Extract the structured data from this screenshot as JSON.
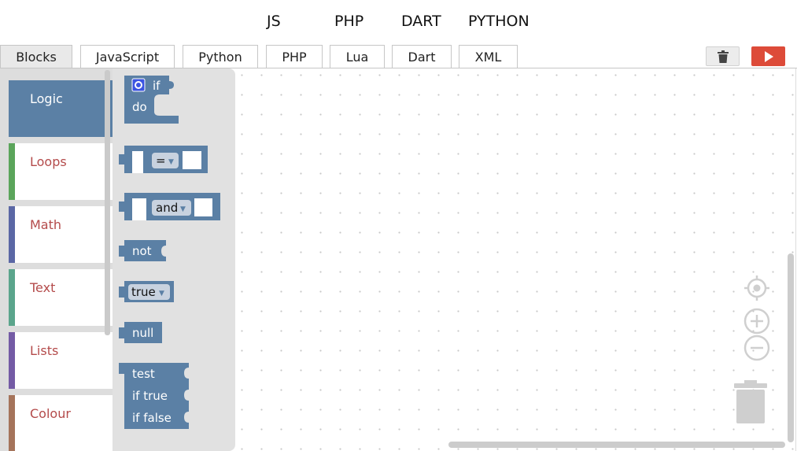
{
  "top_links": [
    "JS",
    "PHP",
    "DART",
    "PYTHON"
  ],
  "tabs": [
    "Blocks",
    "JavaScript",
    "Python",
    "PHP",
    "Lua",
    "Dart",
    "XML"
  ],
  "active_tab": "Blocks",
  "categories": [
    {
      "label": "Logic",
      "color": "#5b80a5"
    },
    {
      "label": "Loops",
      "color": "#5ba55b"
    },
    {
      "label": "Math",
      "color": "#5b67a5"
    },
    {
      "label": "Text",
      "color": "#5ba58c"
    },
    {
      "label": "Lists",
      "color": "#745ba5"
    },
    {
      "label": "Colour",
      "color": "#a5745b"
    }
  ],
  "selected_category": "Logic",
  "category_label_color": "#b44b4b",
  "block_color": "#5b80a5",
  "blocks": {
    "if_label": "if",
    "do_label": "do",
    "compare_op": "=",
    "logic_op": "and",
    "not_label": "not",
    "boolean_value": "true",
    "null_label": "null",
    "ternary_test": "test",
    "ternary_true": "if  true",
    "ternary_false": "if  false"
  },
  "icons": {
    "delete_button": "trash-icon",
    "run_button": "play-icon",
    "recenter": "crosshair-icon",
    "zoom_in": "zoom-in-icon",
    "zoom_out": "zoom-out-icon",
    "workspace_trash": "trashcan-icon",
    "mutator": "gear-icon"
  }
}
